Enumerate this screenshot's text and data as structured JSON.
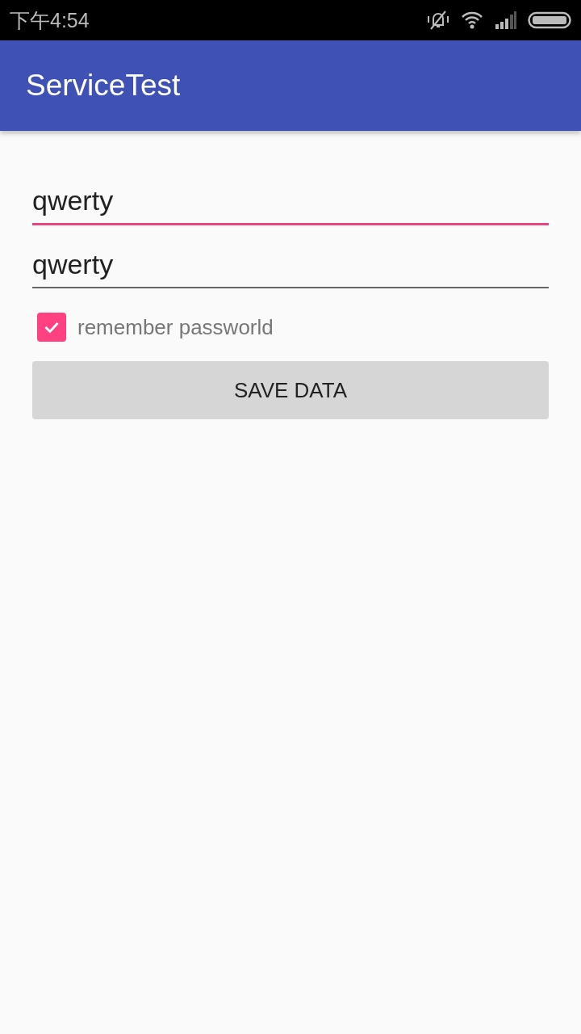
{
  "status_bar": {
    "time": "下午4:54"
  },
  "app_bar": {
    "title": "ServiceTest"
  },
  "fields": [
    {
      "value": "qwerty",
      "focused": true
    },
    {
      "value": "qwerty",
      "focused": false
    }
  ],
  "remember": {
    "label": "remember passworld",
    "checked": true
  },
  "buttons": [
    "SAVE DATA"
  ]
}
